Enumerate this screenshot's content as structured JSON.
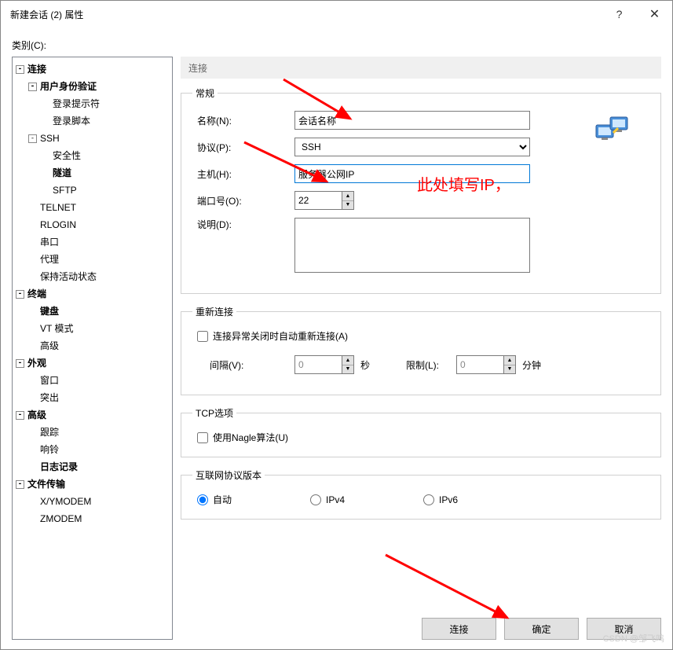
{
  "window": {
    "title": "新建会话 (2) 属性",
    "help": "?",
    "close": "✕"
  },
  "category_label": "类别(C):",
  "tree": {
    "connection": "连接",
    "auth": "用户身份验证",
    "login_prompt": "登录提示符",
    "login_script": "登录脚本",
    "ssh": "SSH",
    "security": "安全性",
    "tunnel": "隧道",
    "sftp": "SFTP",
    "telnet": "TELNET",
    "rlogin": "RLOGIN",
    "serial": "串口",
    "proxy": "代理",
    "keepalive": "保持活动状态",
    "terminal": "终端",
    "keyboard": "键盘",
    "vtmode": "VT 模式",
    "advanced1": "高级",
    "appearance": "外观",
    "window_i": "窗口",
    "highlight": "突出",
    "advanced2": "高级",
    "trace": "跟踪",
    "bell": "响铃",
    "logging": "日志记录",
    "filetransfer": "文件传输",
    "xymodem": "X/YMODEM",
    "zmodem": "ZMODEM"
  },
  "banner": "连接",
  "general": {
    "legend": "常规",
    "name_label": "名称(N):",
    "name_value": "会话名称",
    "protocol_label": "协议(P):",
    "protocol_value": "SSH",
    "host_label": "主机(H):",
    "host_value": "服务器公网IP",
    "port_label": "端口号(O):",
    "port_value": "22",
    "desc_label": "说明(D):"
  },
  "annotation_text": "此处填写IP，",
  "reconnect": {
    "legend": "重新连接",
    "checkbox": "连接异常关闭时自动重新连接(A)",
    "interval_label": "间隔(V):",
    "interval_value": "0",
    "interval_unit": "秒",
    "limit_label": "限制(L):",
    "limit_value": "0",
    "limit_unit": "分钟"
  },
  "tcp": {
    "legend": "TCP选项",
    "nagle": "使用Nagle算法(U)"
  },
  "ip": {
    "legend": "互联网协议版本",
    "auto": "自动",
    "ipv4": "IPv4",
    "ipv6": "IPv6"
  },
  "buttons": {
    "connect": "连接",
    "ok": "确定",
    "cancel": "取消"
  },
  "watermark": "CSDN @邹飞鸣"
}
